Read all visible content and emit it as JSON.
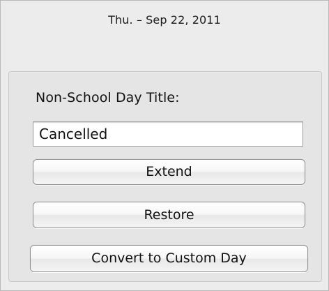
{
  "header": {
    "date": "Thu. – Sep 22, 2011"
  },
  "non_school_day": {
    "title_label": "Non-School Day Title:",
    "title_value": "Cancelled"
  },
  "actions": {
    "extend_label": "Extend",
    "restore_label": "Restore",
    "convert_label": "Convert to Custom Day"
  }
}
